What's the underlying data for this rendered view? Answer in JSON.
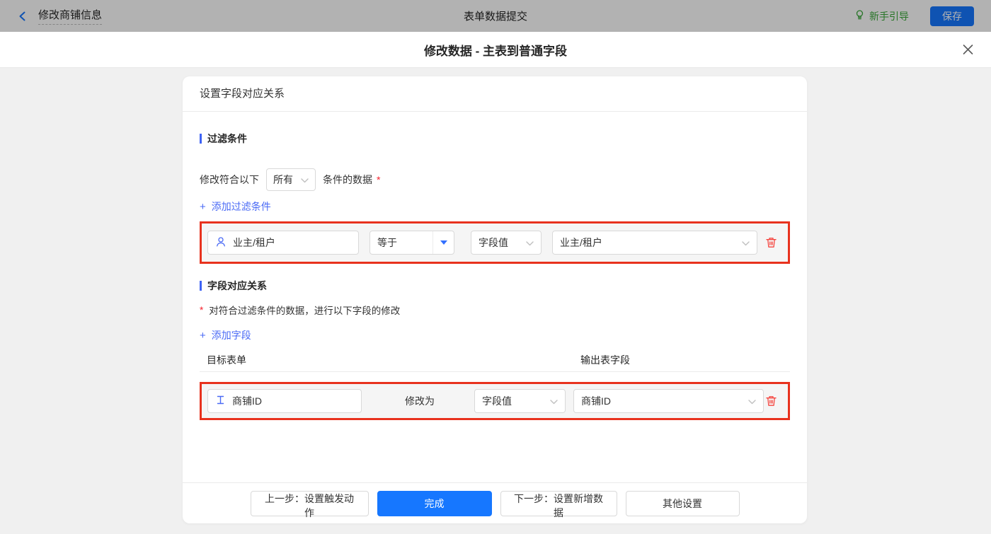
{
  "topbar": {
    "back_label": "修改商铺信息",
    "center_title": "表单数据提交",
    "guide_label": "新手引导",
    "save_label": "保存"
  },
  "modal": {
    "title": "修改数据 - 主表到普通字段"
  },
  "card": {
    "header": "设置字段对应关系",
    "filter_section": {
      "title": "过滤条件",
      "prefix": "修改符合以下",
      "condition_select": "所有",
      "suffix": "条件的数据",
      "required_mark": "*",
      "plus_icon": "+",
      "add_link": "添加过滤条件",
      "row": {
        "field": "业主/租户",
        "operator": "等于",
        "value_type": "字段值",
        "value": "业主/租户"
      }
    },
    "mapping_section": {
      "title": "字段对应关系",
      "required_mark": "*",
      "description": "对符合过滤条件的数据，进行以下字段的修改",
      "plus_icon": "+",
      "add_link": "添加字段",
      "col_target": "目标表单",
      "col_output": "输出表字段",
      "row": {
        "field": "商铺ID",
        "action": "修改为",
        "value_type": "字段值",
        "value": "商铺ID"
      }
    },
    "footer": {
      "prev_label": "上一步：设置触发动作",
      "done_label": "完成",
      "next_label": "下一步：设置新增数据",
      "other_label": "其他设置"
    }
  },
  "colors": {
    "accent_blue": "#1677ff",
    "link_blue": "#4a6af5",
    "section_bar_blue": "#3e63f5",
    "highlight_red": "#e8321e",
    "danger_red": "#f5453f",
    "guide_green": "#3aa83a",
    "page_bg": "#f0f0f0"
  }
}
